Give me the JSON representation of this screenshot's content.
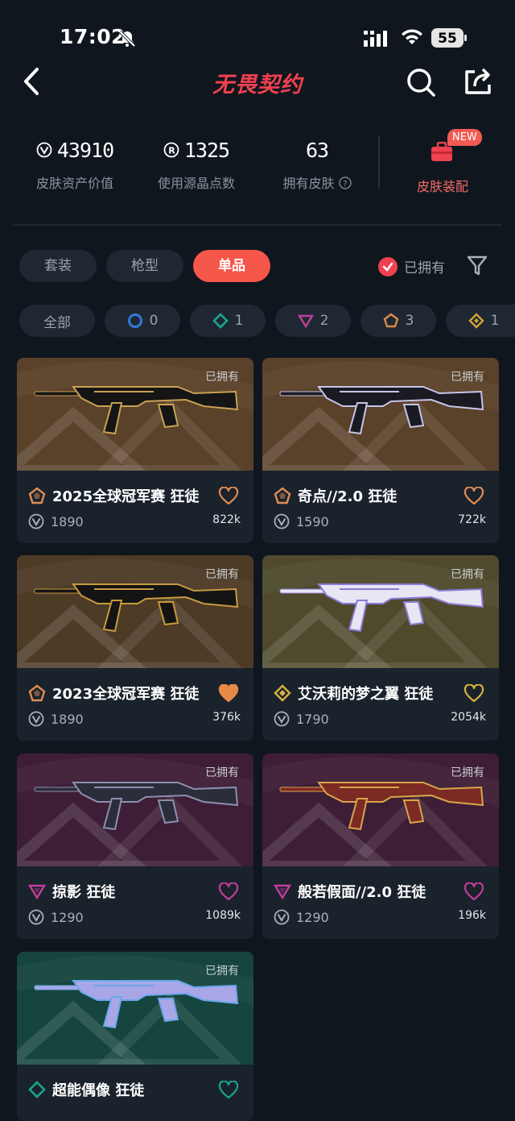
{
  "status_bar": {
    "time": "17:02",
    "battery": "55"
  },
  "header": {
    "title": "无畏契约"
  },
  "stats": {
    "skin_value": {
      "value": "43910",
      "label": "皮肤资产价值"
    },
    "radianite": {
      "value": "1325",
      "label": "使用源晶点数"
    },
    "owned_skins": {
      "value": "63",
      "label": "拥有皮肤"
    },
    "loadout": {
      "label": "皮肤装配",
      "badge": "NEW"
    }
  },
  "tabs": [
    {
      "label": "套装"
    },
    {
      "label": "枪型"
    },
    {
      "label": "单品",
      "active": true
    }
  ],
  "owned_filter": {
    "label": "已拥有",
    "checked": true
  },
  "rarity_chips": [
    {
      "label": "全部"
    },
    {
      "label": "0",
      "icon": "tier0-circle-icon",
      "color": "#2f7bd6"
    },
    {
      "label": "1",
      "icon": "tier1-diamond-icon",
      "color": "#1aa58f"
    },
    {
      "label": "2",
      "icon": "tier2-triangle-icon",
      "color": "#c23d9c"
    },
    {
      "label": "3",
      "icon": "tier3-pentagon-icon",
      "color": "#d98b4a"
    },
    {
      "label": "1",
      "icon": "tier4-diamond-icon",
      "color": "#d2a33b"
    }
  ],
  "cards": [
    {
      "owned": "已拥有",
      "name": "2025全球冠军赛 狂徒",
      "price": "1890",
      "likes": "822k",
      "tier_color": "#e08c55",
      "heart_color": "#e08c55",
      "heart_filled": false,
      "bg": "#5a4129",
      "gun": "#151515",
      "trim": "#c9a154"
    },
    {
      "owned": "已拥有",
      "name": "奇点//2.0 狂徒",
      "price": "1590",
      "likes": "722k",
      "tier_color": "#e08c55",
      "heart_color": "#e08c55",
      "heart_filled": false,
      "bg": "#5a4129",
      "gun": "#1a1a22",
      "trim": "#c7c4e8"
    },
    {
      "owned": "已拥有",
      "name": "2023全球冠军赛 狂徒",
      "price": "1890",
      "likes": "376k",
      "tier_color": "#e08c55",
      "heart_color": "#e88a47",
      "heart_filled": true,
      "bg": "#4e3b26",
      "gun": "#141414",
      "trim": "#c79a3e"
    },
    {
      "owned": "已拥有",
      "name": "艾沃莉的梦之翼 狂徒",
      "price": "1790",
      "likes": "2054k",
      "tier_color": "#d9b13f",
      "heart_color": "#d9b13f",
      "heart_filled": false,
      "bg": "#4f4a2c",
      "gun": "#e8e6f2",
      "trim": "#8c7ad6"
    },
    {
      "owned": "已拥有",
      "name": "掠影 狂徒",
      "price": "1290",
      "likes": "1089k",
      "tier_color": "#c23d9c",
      "heart_color": "#c23d9c",
      "heart_filled": false,
      "bg": "#3e1e36",
      "gun": "#2c2d3a",
      "trim": "#8d8fb0"
    },
    {
      "owned": "已拥有",
      "name": "般若假面//2.0 狂徒",
      "price": "1290",
      "likes": "196k",
      "tier_color": "#c23d9c",
      "heart_color": "#c23d9c",
      "heart_filled": false,
      "bg": "#3e1e36",
      "gun": "#7c2a24",
      "trim": "#d7a64a"
    },
    {
      "owned": "已拥有",
      "name": "超能偶像 狂徒",
      "tier_color": "#1aa58f",
      "heart_color": "#1aa58f",
      "heart_filled": false,
      "bg": "#15453e",
      "gun": "#a9a6e8",
      "trim": "#6aa7e8"
    }
  ]
}
